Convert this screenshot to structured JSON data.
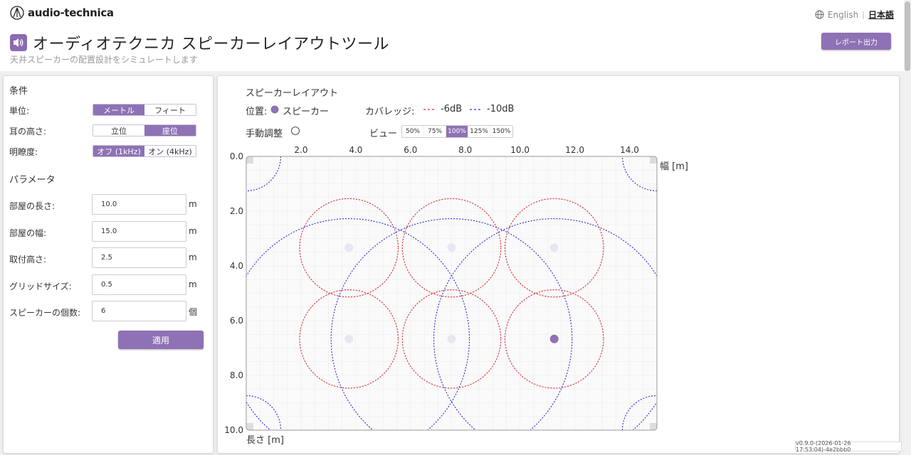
{
  "header": {
    "logo_text": "audio-technica",
    "lang_en": "English",
    "lang_sep": "|",
    "lang_ja": "日本語",
    "title": "オーディオテクニカ スピーカーレイアウトツール",
    "subtitle": "天井スピーカーの配置設計をシミュレートします",
    "report_label": "レポート出力"
  },
  "conditions": {
    "title": "条件",
    "unit_label": "単位:",
    "unit_options": [
      "メートル",
      "フィート"
    ],
    "unit_selected": "メートル",
    "ear_label": "耳の高さ:",
    "ear_options": [
      "立位",
      "座位"
    ],
    "ear_selected": "座位",
    "clarity_label": "明瞭度:",
    "clarity_options": [
      "オフ (1kHz)",
      "オン (4kHz)"
    ],
    "clarity_selected": "オフ (1kHz)"
  },
  "params": {
    "title": "パラメータ",
    "room_length_label": "部屋の長さ:",
    "room_length": "10.0",
    "room_width_label": "部屋の幅:",
    "room_width": "15.0",
    "mount_height_label": "取付高さ:",
    "mount_height": "2.5",
    "grid_size_label": "グリッドサイズ:",
    "grid_size": "0.5",
    "speaker_count_label": "スピーカーの個数:",
    "speaker_count": "6",
    "unit_m": "m",
    "unit_count": "個",
    "apply_label": "適用"
  },
  "layout": {
    "title": "スピーカーレイアウト",
    "position_label": "位置:",
    "speaker_legend": "スピーカー",
    "coverage_label": "カバレッジ:",
    "coverage_6db": "-6dB",
    "coverage_10db": "-10dB",
    "manual_label": "手動調整",
    "view_label": "ビュー",
    "zoom_options": [
      "50%",
      "75%",
      "100%",
      "125%",
      "150%"
    ],
    "zoom_selected": "100%",
    "axis_width_label": "幅 [m]",
    "axis_length_label": "長さ [m]",
    "x_ticks": [
      "2.0",
      "4.0",
      "6.0",
      "8.0",
      "10.0",
      "12.0",
      "14.0"
    ],
    "y_ticks": [
      "0.0",
      "2.0",
      "4.0",
      "6.0",
      "8.0",
      "10.0"
    ],
    "speakers": [
      {
        "x": 3.75,
        "y": 3.33,
        "active": false
      },
      {
        "x": 7.5,
        "y": 3.33,
        "active": false
      },
      {
        "x": 11.25,
        "y": 3.33,
        "active": false
      },
      {
        "x": 3.75,
        "y": 6.67,
        "active": false
      },
      {
        "x": 7.5,
        "y": 6.67,
        "active": false
      },
      {
        "x": 11.25,
        "y": 6.67,
        "active": true
      }
    ],
    "radius_6db_m": 1.8,
    "radius_10db_m": 4.4,
    "colors": {
      "accent": "#8e72b5",
      "red": "#e0262e",
      "blue": "#2a2ad8"
    }
  },
  "version": "v0.9.0-(2026-01-26 17:53:04)-4e2bbb0"
}
